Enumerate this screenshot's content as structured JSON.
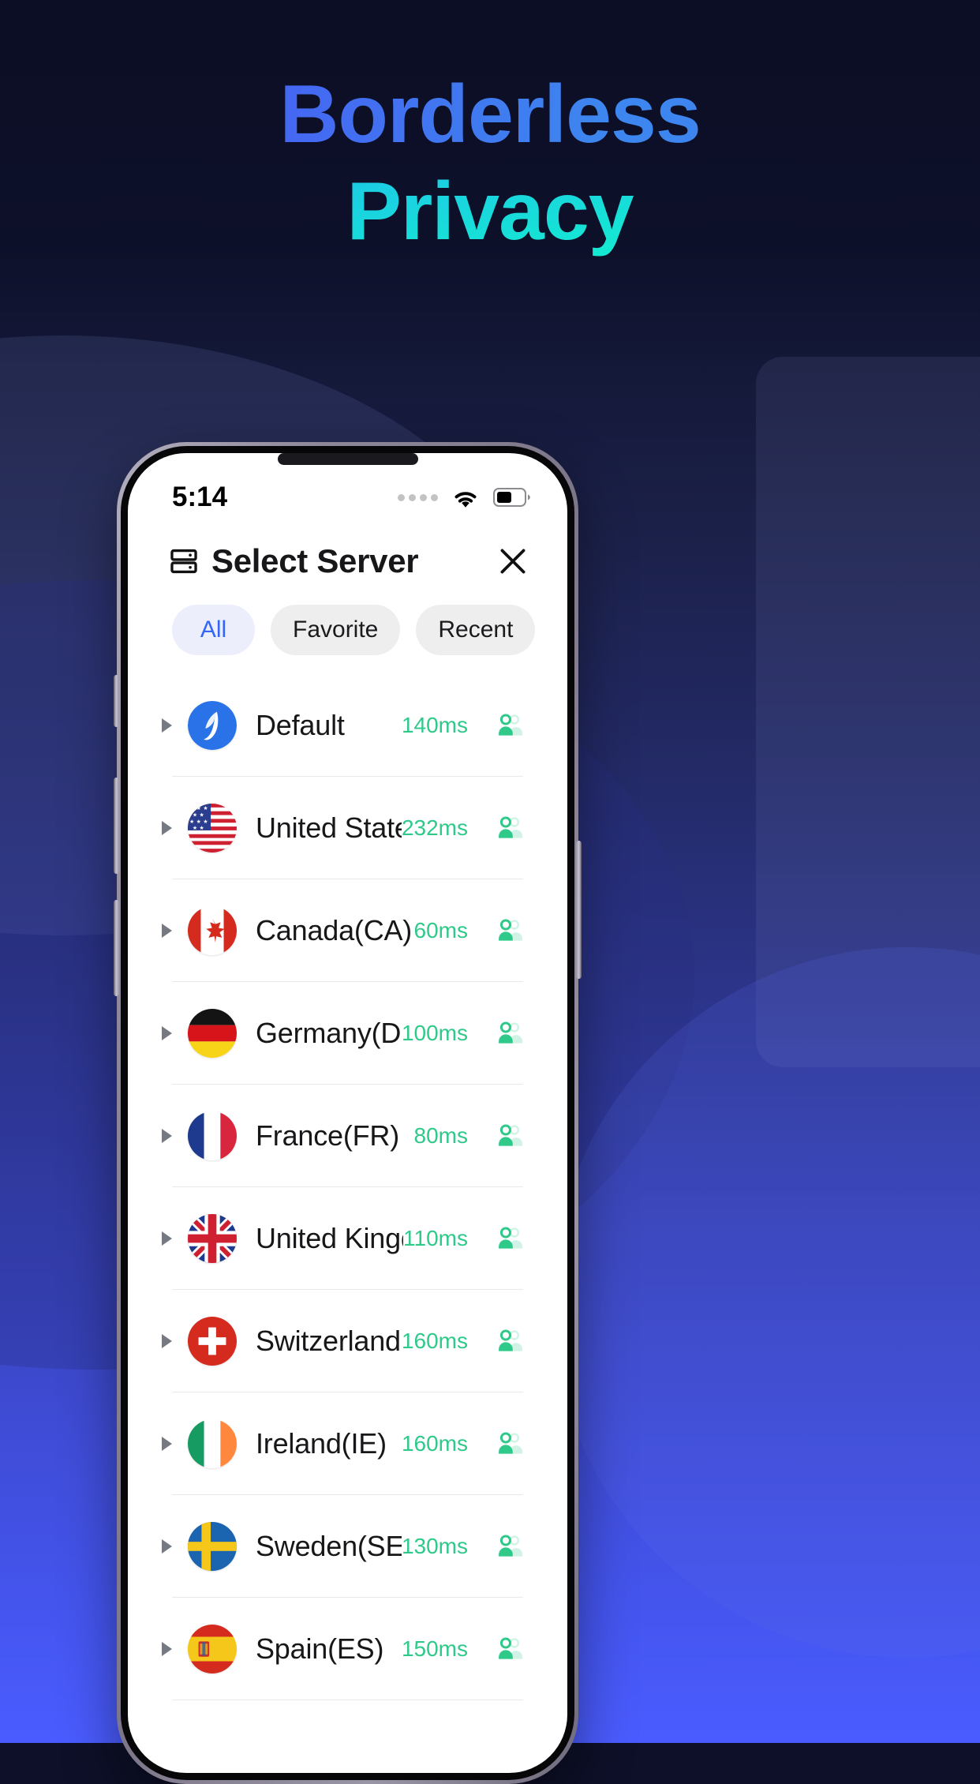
{
  "hero": {
    "line1": "Borderless",
    "line2": "Privacy",
    "color_line1": "#3f7ff0",
    "color_line2": "#14ead0"
  },
  "phone": {
    "status_bar": {
      "time": "5:14",
      "signal_icon": "signal-dots-icon",
      "wifi_icon": "wifi-icon",
      "battery_icon": "battery-icon"
    },
    "header": {
      "icon": "server-rack-icon",
      "title": "Select Server",
      "close_icon": "close-icon"
    },
    "filters": [
      {
        "label": "All",
        "active": true
      },
      {
        "label": "Favorite",
        "active": false
      },
      {
        "label": "Recent",
        "active": false
      }
    ],
    "servers": [
      {
        "name": "Default",
        "ping": "140ms",
        "flag": "default-logo-icon",
        "expand_icon": "chevron-right-icon",
        "users_icon": "users-icon"
      },
      {
        "name": "United States(US)",
        "ping": "232ms",
        "flag": "flag-us-icon",
        "expand_icon": "chevron-right-icon",
        "users_icon": "users-icon"
      },
      {
        "name": "Canada(CA)",
        "ping": "60ms",
        "flag": "flag-ca-icon",
        "expand_icon": "chevron-right-icon",
        "users_icon": "users-icon"
      },
      {
        "name": "Germany(DE)",
        "ping": "100ms",
        "flag": "flag-de-icon",
        "expand_icon": "chevron-right-icon",
        "users_icon": "users-icon"
      },
      {
        "name": "France(FR)",
        "ping": "80ms",
        "flag": "flag-fr-icon",
        "expand_icon": "chevron-right-icon",
        "users_icon": "users-icon"
      },
      {
        "name": "United Kingdom(...",
        "ping": "110ms",
        "flag": "flag-gb-icon",
        "expand_icon": "chevron-right-icon",
        "users_icon": "users-icon"
      },
      {
        "name": "Switzerland(CH)",
        "ping": "160ms",
        "flag": "flag-ch-icon",
        "expand_icon": "chevron-right-icon",
        "users_icon": "users-icon"
      },
      {
        "name": "Ireland(IE)",
        "ping": "160ms",
        "flag": "flag-ie-icon",
        "expand_icon": "chevron-right-icon",
        "users_icon": "users-icon"
      },
      {
        "name": "Sweden(SE)",
        "ping": "130ms",
        "flag": "flag-se-icon",
        "expand_icon": "chevron-right-icon",
        "users_icon": "users-icon"
      },
      {
        "name": "Spain(ES)",
        "ping": "150ms",
        "flag": "flag-es-icon",
        "expand_icon": "chevron-right-icon",
        "users_icon": "users-icon"
      }
    ],
    "colors": {
      "ping_green": "#2fc98a",
      "chip_active_text": "#3366f4",
      "chip_active_bg": "#eceefc",
      "chip_bg": "#eeeeef"
    }
  }
}
